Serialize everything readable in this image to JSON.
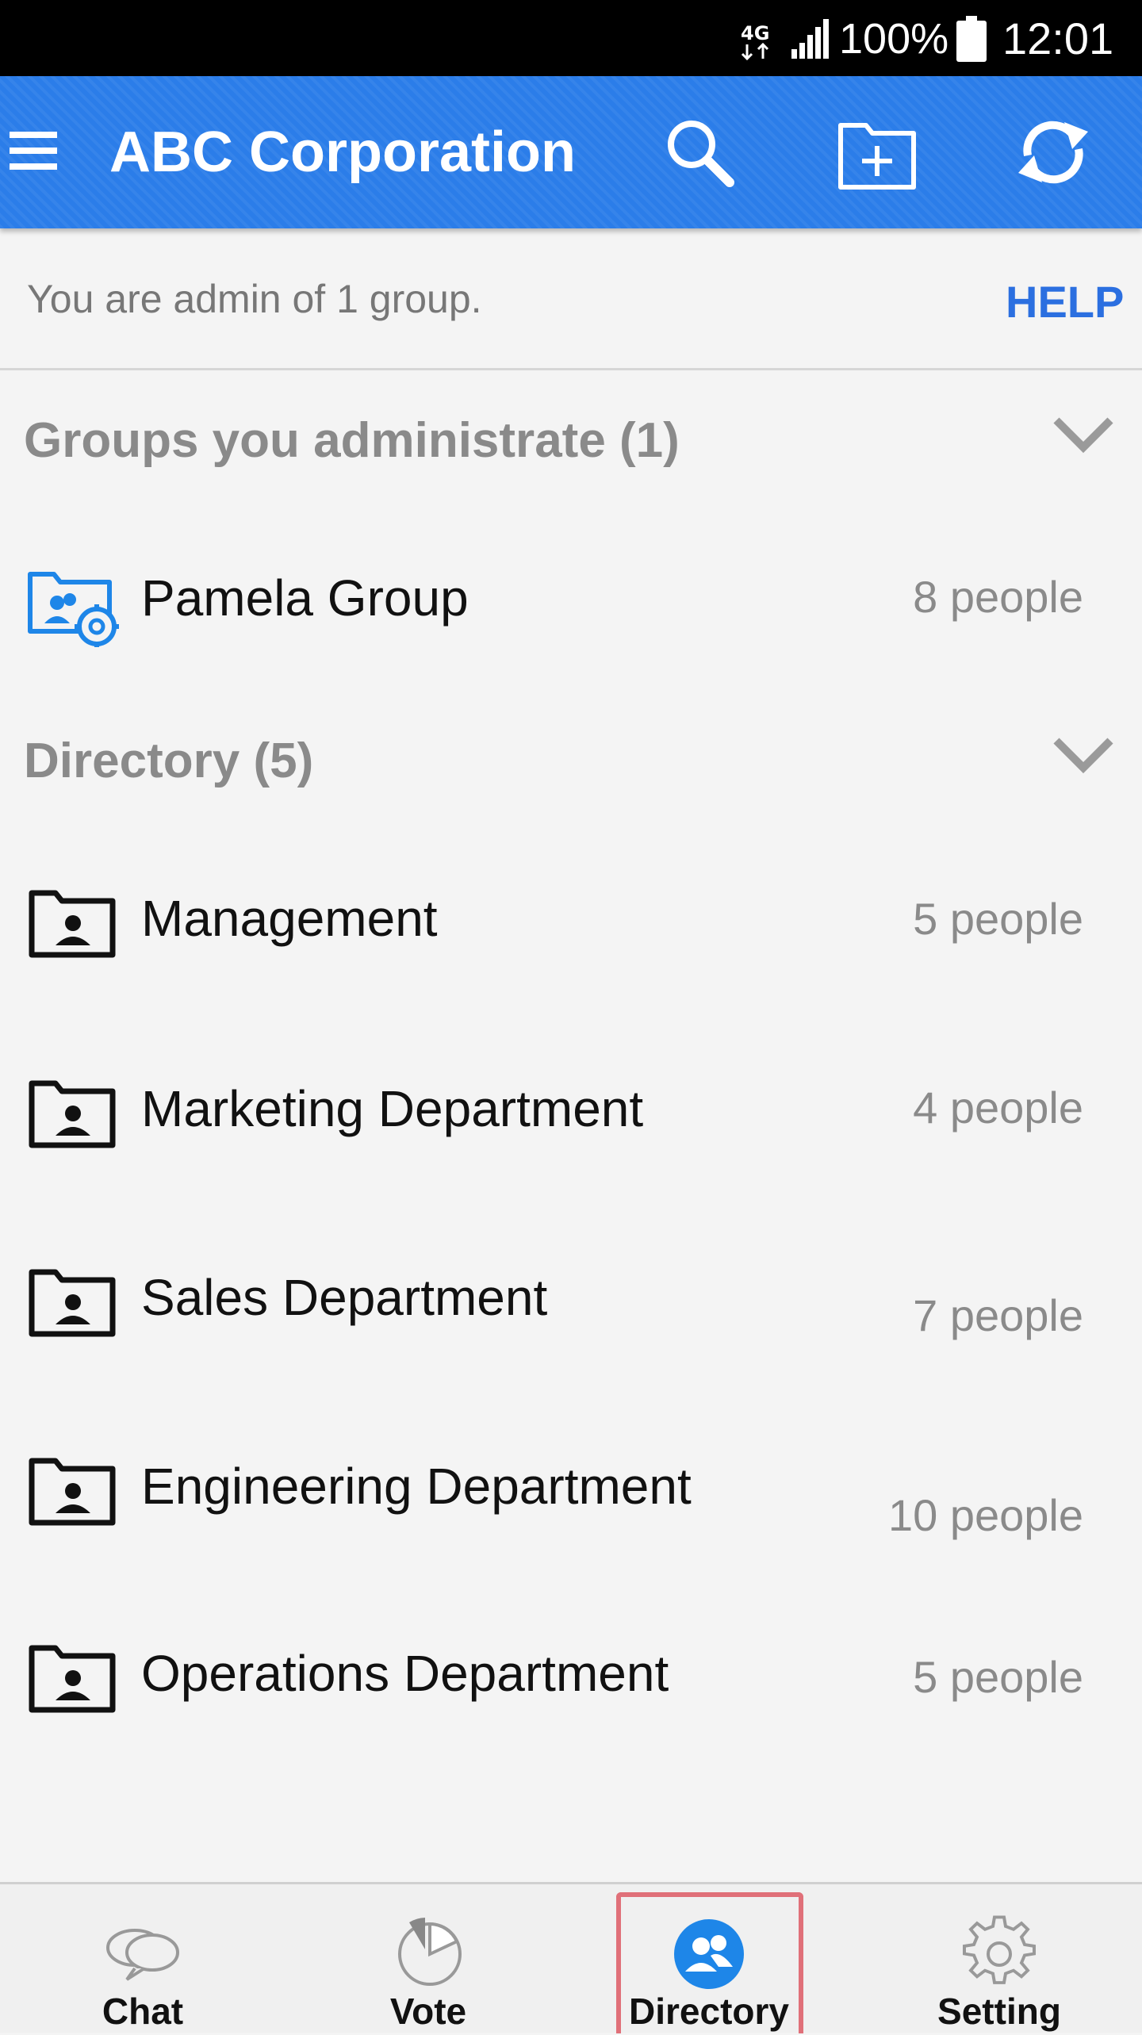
{
  "status_bar": {
    "network": "4G",
    "battery_percent": "100%",
    "time": "12:01"
  },
  "app_bar": {
    "title": "ABC Corporation",
    "icons": [
      "menu-icon",
      "search-icon",
      "add-folder-icon",
      "refresh-icon"
    ]
  },
  "admin_notice": {
    "message": "You are admin of 1 group.",
    "help_label": "HELP"
  },
  "admin_section": {
    "header": "Groups you administrate (1)",
    "groups": [
      {
        "name": "Pamela Group",
        "count": "8 people",
        "icon": "admin-group-icon"
      }
    ]
  },
  "directory_section": {
    "header": "Directory (5)",
    "groups": [
      {
        "name": "Management",
        "count": "5 people",
        "icon": "folder-contact-icon"
      },
      {
        "name": "Marketing Department",
        "count": "4 people",
        "icon": "folder-contact-icon"
      },
      {
        "name": "Sales Department",
        "count": "7 people",
        "icon": "folder-contact-icon"
      },
      {
        "name": "Engineering Department",
        "count": "10 people",
        "icon": "folder-contact-icon"
      },
      {
        "name": "Operations Department",
        "count": "5 people",
        "icon": "folder-contact-icon"
      }
    ]
  },
  "bottom_nav": {
    "items": [
      {
        "label": "Chat",
        "icon": "chat-bubbles-icon"
      },
      {
        "label": "Vote",
        "icon": "pie-chart-icon"
      },
      {
        "label": "Directory",
        "icon": "contacts-icon"
      },
      {
        "label": "Setting",
        "icon": "gear-icon"
      }
    ],
    "active": "Directory"
  },
  "colors": {
    "app_bar": "#2b7de9",
    "accent_link": "#2b6fe0",
    "active_highlight": "#e07079",
    "background": "#f4f4f4"
  }
}
